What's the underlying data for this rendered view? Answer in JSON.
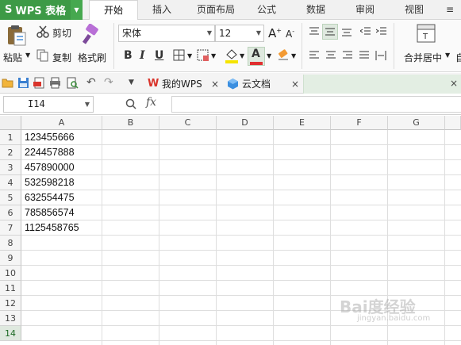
{
  "app": {
    "logo": "S",
    "title": "WPS 表格",
    "accent": "#3d9a46"
  },
  "menu": {
    "tabs": [
      "开始",
      "插入",
      "页面布局",
      "公式",
      "数据",
      "审阅",
      "视图"
    ],
    "active": "开始"
  },
  "ribbon": {
    "paste": "粘贴",
    "cut": "剪切",
    "copy": "复制",
    "format_painter": "格式刷",
    "font_name": "宋体",
    "font_size": "12",
    "bold": "B",
    "italic": "I",
    "underline": "U",
    "merge_center": "合并居中",
    "font_color": "#e03030",
    "fill_color": "#f5e400"
  },
  "quickbar": {
    "tabs": [
      {
        "label": "我的WPS",
        "icon": "wps-w-icon"
      },
      {
        "label": "云文档",
        "icon": "cloud-doc-icon"
      }
    ],
    "close_glyph": "×"
  },
  "formula_bar": {
    "cell_ref": "I14",
    "fx": "fx",
    "value": ""
  },
  "sheet": {
    "columns": [
      "A",
      "B",
      "C",
      "D",
      "E",
      "F",
      "G"
    ],
    "rows": [
      "1",
      "2",
      "3",
      "4",
      "5",
      "6",
      "7",
      "8",
      "9",
      "10",
      "11",
      "12",
      "13",
      "14"
    ],
    "active_row": "14",
    "col_a_values": [
      "123455666",
      "224457888",
      "457890000",
      "532598218",
      "632554475",
      "785856574",
      "1125458765"
    ]
  },
  "watermark": {
    "text": "Bai度经验",
    "sub": "jingyan.baidu.com"
  }
}
